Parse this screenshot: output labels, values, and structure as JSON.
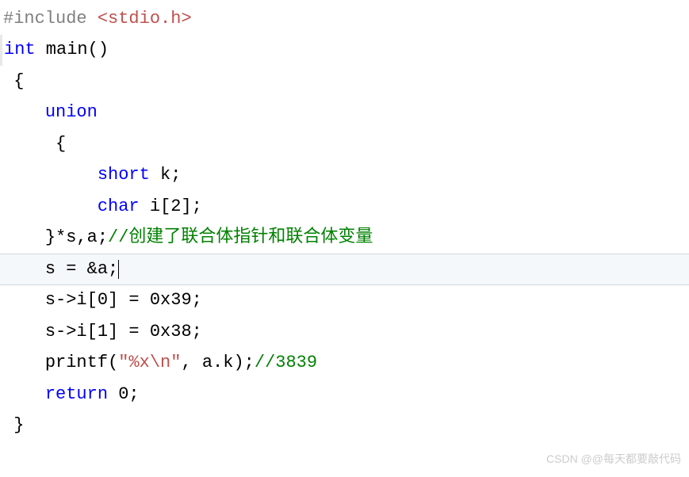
{
  "code": {
    "line1": {
      "include": "#include",
      "header": " <stdio.h>"
    },
    "line2": {
      "type": "int",
      "main": " main()"
    },
    "line3": {
      "brace": " {"
    },
    "line4": {
      "indent": "    ",
      "keyword": "union"
    },
    "line5": {
      "indent": "     ",
      "brace": "{"
    },
    "line6": {
      "indent": "         ",
      "type": "short",
      "var": " k;"
    },
    "line7": {
      "indent": "         ",
      "type": "char",
      "var": " i[2];"
    },
    "line8": {
      "indent": "    ",
      "brace": "}",
      "vars": "*s,a;",
      "comment": "//创建了联合体指针和联合体变量"
    },
    "line9": {
      "indent": "    ",
      "code": "s = &a;"
    },
    "line10": {
      "indent": "    ",
      "code": "s->i[0] = 0x39;"
    },
    "line11": {
      "indent": "    ",
      "code": "s->i[1] = 0x38;"
    },
    "line12": {
      "indent": "    ",
      "func": "printf",
      "paren1": "(",
      "string": "\"%x\\n\"",
      "args": ", a.k);",
      "comment": "//3839"
    },
    "line13": {
      "indent": "    ",
      "keyword": "return",
      "val": " 0;"
    },
    "line14": {
      "brace": " }"
    }
  },
  "watermark": "CSDN @@每天都要敲代码"
}
